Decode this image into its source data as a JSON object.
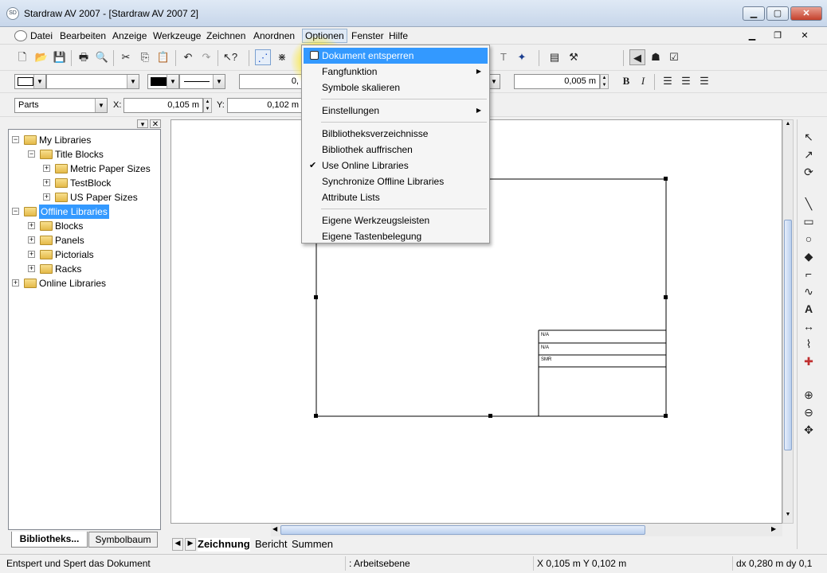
{
  "window": {
    "title": "Stardraw AV 2007  - [Stardraw AV 2007 2]",
    "min": "▁",
    "max": "▢",
    "close": "✕"
  },
  "menubar": {
    "items": [
      "Datei",
      "Bearbeiten",
      "Anzeige",
      "Werkzeuge",
      "Zeichnen",
      "Anordnen",
      "Optionen",
      "Fenster",
      "Hilfe"
    ],
    "mdi_min": "▁",
    "mdi_restore": "❐",
    "mdi_close": "✕"
  },
  "toolbar2": {
    "value_left": "0,",
    "value_right": "0,005 m"
  },
  "toolbar3": {
    "parts": "Parts",
    "x_label": "X:",
    "x_value": "0,105 m",
    "y_label": "Y:",
    "y_value": "0,102 m"
  },
  "library": {
    "tree": [
      {
        "label": "My Libraries",
        "level": 0,
        "exp": "−"
      },
      {
        "label": "Title Blocks",
        "level": 1,
        "exp": "−"
      },
      {
        "label": "Metric Paper Sizes",
        "level": 2,
        "exp": "+"
      },
      {
        "label": "TestBlock",
        "level": 2,
        "exp": "+"
      },
      {
        "label": "US Paper Sizes",
        "level": 2,
        "exp": "+"
      },
      {
        "label": "Offline Libraries",
        "level": 0,
        "exp": "−",
        "selected": true
      },
      {
        "label": "Blocks",
        "level": 1,
        "exp": "+"
      },
      {
        "label": "Panels",
        "level": 1,
        "exp": "+"
      },
      {
        "label": "Pictorials",
        "level": 1,
        "exp": "+"
      },
      {
        "label": "Racks",
        "level": 1,
        "exp": "+"
      },
      {
        "label": "Online Libraries",
        "level": 0,
        "exp": "+"
      }
    ],
    "tabs": [
      "Bibliotheks...",
      "Symbolbaum"
    ]
  },
  "drawing": {
    "title_block_cells": [
      "N/A",
      "N/A",
      "SMR"
    ]
  },
  "sheet_tabs": [
    "Zeichnung",
    "Bericht",
    "Summen"
  ],
  "dropdown": {
    "items": [
      {
        "label": "Dokument entsperren",
        "highlight": true
      },
      {
        "label": "Fangfunktion",
        "submenu": true
      },
      {
        "label": "Symbole skalieren"
      },
      {
        "sep": true
      },
      {
        "label": "Einstellungen",
        "submenu": true
      },
      {
        "sep": true
      },
      {
        "label": "Bilbliotheksverzeichnisse"
      },
      {
        "label": "Bibliothek auffrischen"
      },
      {
        "label": "Use Online Libraries",
        "checked": true
      },
      {
        "label": "Synchronize Offline Libraries"
      },
      {
        "label": "Attribute Lists"
      },
      {
        "sep": true
      },
      {
        "label": "Eigene Werkzeugsleisten"
      },
      {
        "label": "Eigene Tastenbelegung"
      }
    ]
  },
  "statusbar": {
    "message": "Entspert und Spert das Dokument",
    "layer": ": Arbeitsebene",
    "coords": "X 0,105 m Y 0,102 m",
    "delta": "dx 0,280 m dy 0,1"
  }
}
